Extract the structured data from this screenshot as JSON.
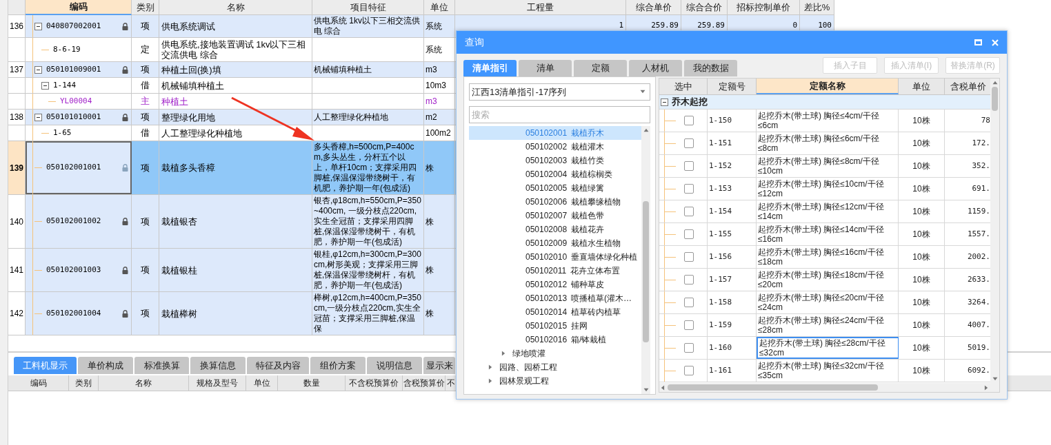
{
  "main_table": {
    "columns": [
      {
        "label": "编码",
        "selected": true
      },
      {
        "label": "类别",
        "selected": false
      },
      {
        "label": "名称",
        "selected": false
      },
      {
        "label": "项目特征",
        "selected": false
      },
      {
        "label": "单位",
        "selected": false
      },
      {
        "label": "工程量",
        "selected": false
      },
      {
        "label": "综合单价",
        "selected": false
      },
      {
        "label": "综合合价",
        "selected": false
      },
      {
        "label": "招标控制单价",
        "selected": false
      },
      {
        "label": "差比%",
        "selected": false
      }
    ],
    "rows": [
      {
        "kind": "item",
        "number": "136",
        "code": "040807002001",
        "locked": true,
        "expanded": true,
        "selected": false,
        "type": "项",
        "name": "供电系统调试",
        "feature": "供电系统 1kv以下三相交流供电 综合",
        "unit": "系统",
        "values": [
          "1",
          "259.89",
          "259.89",
          "0",
          "100"
        ],
        "children": [
          {
            "kind": "sub",
            "code": "8-6-19",
            "selected": false,
            "type": "定",
            "name": "供电系统,接地装置调试 1kv以下三相交流供电 综合",
            "unit": "系统"
          }
        ]
      },
      {
        "kind": "item",
        "number": "137",
        "code": "050101009001",
        "locked": true,
        "expanded": true,
        "selected": false,
        "type": "项",
        "name": "种植土回(换)填",
        "feature": "机械铺填种植土",
        "unit": "m3",
        "children": [
          {
            "kind": "sub",
            "code": "1-144",
            "expanded": true,
            "selected": false,
            "type": "借",
            "name": "机械铺填种植土",
            "unit": "10m3",
            "children": [
              {
                "kind": "material",
                "code": "YL00004",
                "selected": false,
                "type": "主",
                "name": "种植土",
                "unit": "m3"
              }
            ]
          }
        ]
      },
      {
        "kind": "item",
        "number": "138",
        "code": "050101010001",
        "locked": true,
        "expanded": true,
        "selected": false,
        "type": "项",
        "name": "整理绿化用地",
        "feature": "人工整理绿化种植地",
        "unit": "m2",
        "children": [
          {
            "kind": "sub",
            "code": "1-65",
            "selected": false,
            "type": "借",
            "name": "人工整理绿化种植地",
            "unit": "100m2"
          }
        ]
      },
      {
        "kind": "item",
        "number": "139",
        "code": "050102001001",
        "locked": true,
        "selected": true,
        "type": "项",
        "name": "栽植多头香樟",
        "feature": "多头香樟,h=500cm,P=400cm,多头丛生，分杆五个以上，单杆10cm；支撑采用四脚桩,保温保湿带绕树干，有机肥，养护期一年(包成活)",
        "unit": "株"
      },
      {
        "kind": "item",
        "number": "140",
        "code": "050102001002",
        "locked": true,
        "selected": false,
        "type": "项",
        "name": "栽植银杏",
        "feature": "银杏,φ18cm,h=550cm,P=350~400cm, 一级分枝点220cm,实生全冠苗；支撑采用四脚桩,保温保湿带绕树干，有机肥，养护期一年(包成活)",
        "unit": "株"
      },
      {
        "kind": "item",
        "number": "141",
        "code": "050102001003",
        "locked": true,
        "selected": false,
        "type": "项",
        "name": "栽植银桂",
        "feature": "银桂,φ12cm,h=300cm,P=300cm,树形美观；支撑采用三脚桩,保温保湿带绕树杆，有机肥，养护期一年(包成活)",
        "unit": "株"
      },
      {
        "kind": "item",
        "number": "142",
        "code": "050102001004",
        "locked": true,
        "selected": false,
        "type": "项",
        "name": "栽植榉树",
        "feature": "榉树,φ12cm,h=400cm,P=350cm,一级分枝点220cm,实生全冠苗；支撑采用三脚桩,保温保",
        "unit": "株"
      }
    ]
  },
  "bottom_panel": {
    "tabs": [
      {
        "label": "工料机显示",
        "selected": true
      },
      {
        "label": "单价构成",
        "selected": false
      },
      {
        "label": "标准换算",
        "selected": false
      },
      {
        "label": "换算信息",
        "selected": false
      },
      {
        "label": "特征及内容",
        "selected": false
      },
      {
        "label": "组价方案",
        "selected": false
      },
      {
        "label": "说明信息",
        "selected": false
      },
      {
        "label": "显示来",
        "selected": false
      }
    ],
    "columns": [
      "编码",
      "类别",
      "名称",
      "规格及型号",
      "单位",
      "数量",
      "不含税预算价",
      "含税预算价",
      "不"
    ]
  },
  "dialog": {
    "title": "查询",
    "tabs": [
      {
        "label": "清单指引",
        "selected": true
      },
      {
        "label": "清单",
        "selected": false
      },
      {
        "label": "定额",
        "selected": false
      },
      {
        "label": "人材机",
        "selected": false
      },
      {
        "label": "我的数据",
        "selected": false
      }
    ],
    "buttons": [
      {
        "label": "插入子目",
        "disabled": true
      },
      {
        "label": "插入清单(I)",
        "disabled": true
      },
      {
        "label": "替换清单(R)",
        "disabled": true
      }
    ],
    "library": {
      "value": "江西13清单指引-17序列"
    },
    "search": {
      "placeholder": "搜索"
    },
    "tree": [
      {
        "children": [
          {
            "children": [
              {
                "code": "050102001",
                "name": "栽植乔木",
                "selected": true
              },
              {
                "code": "050102002",
                "name": "栽植灌木",
                "selected": false
              },
              {
                "code": "050102003",
                "name": "栽植竹类",
                "selected": false
              },
              {
                "code": "050102004",
                "name": "栽植棕榈类",
                "selected": false
              },
              {
                "code": "050102005",
                "name": "栽植绿篱",
                "selected": false
              },
              {
                "code": "050102006",
                "name": "栽植攀缘植物",
                "selected": false
              },
              {
                "code": "050102007",
                "name": "栽植色带",
                "selected": false
              },
              {
                "code": "050102008",
                "name": "栽植花卉",
                "selected": false
              },
              {
                "code": "050102009",
                "name": "栽植水生植物",
                "selected": false
              },
              {
                "code": "050102010",
                "name": "垂直墙体绿化种植",
                "selected": false
              },
              {
                "code": "050102011",
                "name": "花卉立体布置",
                "selected": false
              },
              {
                "code": "050102012",
                "name": "铺种草皮",
                "selected": false
              },
              {
                "code": "050102013",
                "name": "喷播植草(灌木…",
                "selected": false
              },
              {
                "code": "050102014",
                "name": "植草砖内植草",
                "selected": false
              },
              {
                "code": "050102015",
                "name": "挂网",
                "selected": false
              },
              {
                "code": "050102016",
                "name": "箱/钵栽植",
                "selected": false
              }
            ]
          },
          {
            "name": "绿地喷灌",
            "expanded": false,
            "selected": false
          }
        ]
      },
      {
        "name": "园路、园桥工程",
        "expanded": false,
        "selected": false
      },
      {
        "name": "园林景观工程",
        "expanded": false,
        "selected": false
      }
    ],
    "grid": {
      "columns": [
        {
          "label": "选中",
          "selected": false
        },
        {
          "label": "定额号",
          "selected": false
        },
        {
          "label": "定额名称",
          "selected": true
        },
        {
          "label": "单位",
          "selected": false
        },
        {
          "label": "含税单价",
          "selected": false
        }
      ],
      "group": {
        "name": "乔木起挖",
        "expanded": true
      },
      "rows": [
        {
          "checked": false,
          "code": "1-150",
          "name": "起挖乔木(带土球) 胸径≤4cm/干径≤6cm",
          "unit": "10株",
          "price": "78",
          "selected": false
        },
        {
          "checked": false,
          "code": "1-151",
          "name": "起挖乔木(带土球) 胸径≤6cm/干径≤8cm",
          "unit": "10株",
          "price": "172.",
          "selected": false
        },
        {
          "checked": false,
          "code": "1-152",
          "name": "起挖乔木(带土球) 胸径≤8cm/干径≤10cm",
          "unit": "10株",
          "price": "352.",
          "selected": false
        },
        {
          "checked": false,
          "code": "1-153",
          "name": "起挖乔木(带土球) 胸径≤10cm/干径≤12cm",
          "unit": "10株",
          "price": "691.",
          "selected": false
        },
        {
          "checked": false,
          "code": "1-154",
          "name": "起挖乔木(带土球) 胸径≤12cm/干径≤14cm",
          "unit": "10株",
          "price": "1159.",
          "selected": false
        },
        {
          "checked": false,
          "code": "1-155",
          "name": "起挖乔木(带土球) 胸径≤14cm/干径≤16cm",
          "unit": "10株",
          "price": "1557.",
          "selected": false
        },
        {
          "checked": false,
          "code": "1-156",
          "name": "起挖乔木(带土球) 胸径≤16cm/干径≤18cm",
          "unit": "10株",
          "price": "2002.",
          "selected": false
        },
        {
          "checked": false,
          "code": "1-157",
          "name": "起挖乔木(带土球) 胸径≤18cm/干径≤20cm",
          "unit": "10株",
          "price": "2633.",
          "selected": false
        },
        {
          "checked": false,
          "code": "1-158",
          "name": "起挖乔木(带土球) 胸径≤20cm/干径≤24cm",
          "unit": "10株",
          "price": "3264.",
          "selected": false
        },
        {
          "checked": false,
          "code": "1-159",
          "name": "起挖乔木(带土球) 胸径≤24cm/干径≤28cm",
          "unit": "10株",
          "price": "4007.",
          "selected": false
        },
        {
          "checked": false,
          "code": "1-160",
          "name": "起挖乔木(带土球) 胸径≤28cm/干径≤32cm",
          "unit": "10株",
          "price": "5019.",
          "selected": true
        },
        {
          "checked": false,
          "code": "1-161",
          "name": "起挖乔木(带土球) 胸径≤32cm/干径≤35cm",
          "unit": "10株",
          "price": "6092.",
          "selected": false
        }
      ]
    }
  }
}
